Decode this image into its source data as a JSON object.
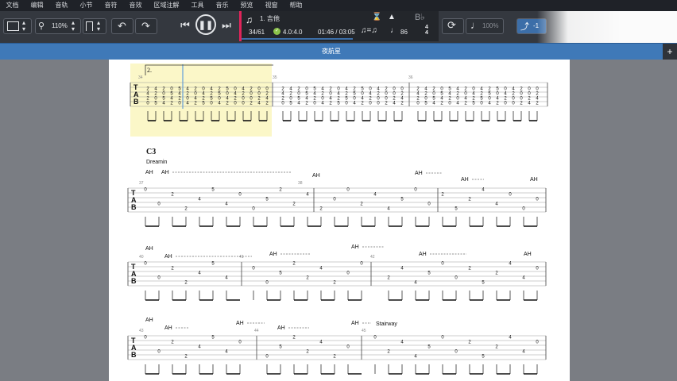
{
  "menu": [
    "文档",
    "编辑",
    "音轨",
    "小节",
    "音符",
    "音效",
    "区域注解",
    "工具",
    "音乐",
    "预览",
    "视窗",
    "帮助"
  ],
  "toolbar": {
    "zoom": "110%",
    "track_name": "1. 吉他",
    "position": "34/61",
    "time_signature": "4.0:4.0",
    "time": "01:46 / 03:05",
    "tempo": "86",
    "speed": "100%",
    "key_label": "B♭",
    "volume_label": "-1"
  },
  "document": {
    "title": "夜航星"
  },
  "score": {
    "volta": "2.",
    "section": "C3",
    "section_sub": "Dreamin",
    "stairway_text": "Stairway",
    "measure_numbers": [
      "34",
      "35",
      "36",
      "37",
      "38",
      "40",
      "41",
      "42",
      "43",
      "44",
      "45"
    ],
    "ah_labels": [
      "AH",
      "AH",
      "AH",
      "AH",
      "AH",
      "AH",
      "AH",
      "AH",
      "AH",
      "AH",
      "AH",
      "AH",
      "AH",
      "AH",
      "AH",
      "AH",
      "AH"
    ]
  },
  "colors": {
    "accent": "#e0245a",
    "tab_blue": "#3f79b8",
    "highlight": "#fbf7c8",
    "toolbar": "#34383f"
  }
}
